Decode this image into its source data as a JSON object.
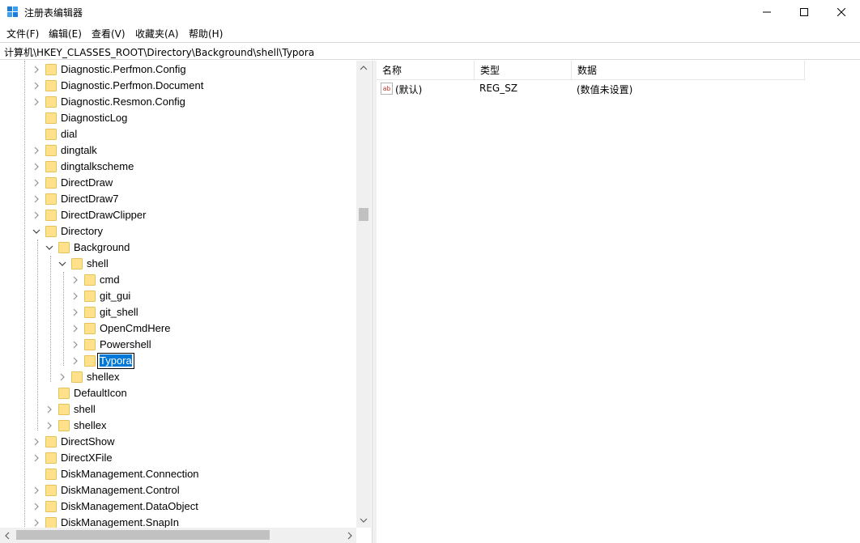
{
  "window": {
    "title": "注册表编辑器",
    "minimize_icon": "minimize-icon",
    "maximize_icon": "maximize-icon",
    "close_icon": "close-icon"
  },
  "menu": [
    {
      "label": "文件(F)"
    },
    {
      "label": "编辑(E)"
    },
    {
      "label": "查看(V)"
    },
    {
      "label": "收藏夹(A)"
    },
    {
      "label": "帮助(H)"
    }
  ],
  "address": {
    "path": "计算机\\HKEY_CLASSES_ROOT\\Directory\\Background\\shell\\Typora"
  },
  "tree": {
    "items": [
      {
        "label": "Diagnostic.Perfmon.Config",
        "depth": 0,
        "state": "collapsed"
      },
      {
        "label": "Diagnostic.Perfmon.Document",
        "depth": 0,
        "state": "collapsed"
      },
      {
        "label": "Diagnostic.Resmon.Config",
        "depth": 0,
        "state": "collapsed"
      },
      {
        "label": "DiagnosticLog",
        "depth": 0,
        "state": "leaf"
      },
      {
        "label": "dial",
        "depth": 0,
        "state": "leaf"
      },
      {
        "label": "dingtalk",
        "depth": 0,
        "state": "collapsed"
      },
      {
        "label": "dingtalkscheme",
        "depth": 0,
        "state": "collapsed"
      },
      {
        "label": "DirectDraw",
        "depth": 0,
        "state": "collapsed"
      },
      {
        "label": "DirectDraw7",
        "depth": 0,
        "state": "collapsed"
      },
      {
        "label": "DirectDrawClipper",
        "depth": 0,
        "state": "collapsed"
      },
      {
        "label": "Directory",
        "depth": 0,
        "state": "expanded"
      },
      {
        "label": "Background",
        "depth": 1,
        "state": "expanded"
      },
      {
        "label": "shell",
        "depth": 2,
        "state": "expanded"
      },
      {
        "label": "cmd",
        "depth": 3,
        "state": "collapsed"
      },
      {
        "label": "git_gui",
        "depth": 3,
        "state": "collapsed"
      },
      {
        "label": "git_shell",
        "depth": 3,
        "state": "collapsed"
      },
      {
        "label": "OpenCmdHere",
        "depth": 3,
        "state": "collapsed"
      },
      {
        "label": "Powershell",
        "depth": 3,
        "state": "collapsed"
      },
      {
        "label": "Typora",
        "depth": 3,
        "state": "editing"
      },
      {
        "label": "shellex",
        "depth": 2,
        "state": "collapsed"
      },
      {
        "label": "DefaultIcon",
        "depth": 1,
        "state": "leaf"
      },
      {
        "label": "shell",
        "depth": 1,
        "state": "collapsed"
      },
      {
        "label": "shellex",
        "depth": 1,
        "state": "collapsed"
      },
      {
        "label": "DirectShow",
        "depth": 0,
        "state": "collapsed"
      },
      {
        "label": "DirectXFile",
        "depth": 0,
        "state": "collapsed"
      },
      {
        "label": "DiskManagement.Connection",
        "depth": 0,
        "state": "leaf"
      },
      {
        "label": "DiskManagement.Control",
        "depth": 0,
        "state": "collapsed"
      },
      {
        "label": "DiskManagement.DataObject",
        "depth": 0,
        "state": "collapsed"
      },
      {
        "label": "DiskManagement.SnapIn",
        "depth": 0,
        "state": "collapsed"
      }
    ]
  },
  "list": {
    "columns": [
      "名称",
      "类型",
      "数据"
    ],
    "rows": [
      {
        "icon": "string-value-icon",
        "name": "(默认)",
        "type": "REG_SZ",
        "data": "(数值未设置)"
      }
    ]
  },
  "colors": {
    "folder": "#ffe18c",
    "selection": "#0078d7"
  }
}
